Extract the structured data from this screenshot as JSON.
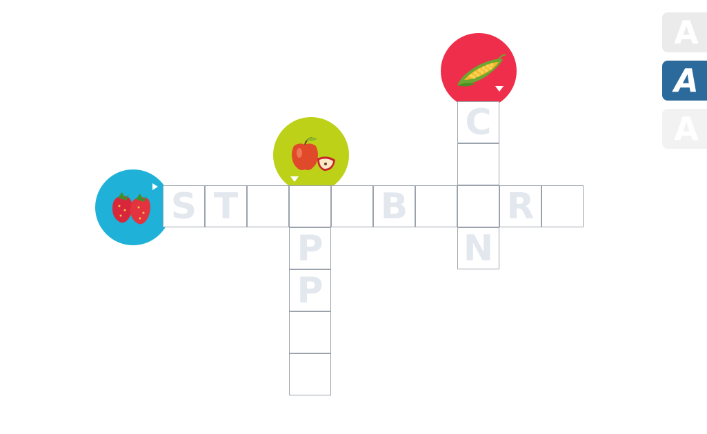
{
  "crossword": {
    "across_strawberry": [
      "S",
      "T",
      "",
      "",
      "",
      "B",
      "",
      "",
      "R",
      ""
    ],
    "down_apple": [
      "P",
      "P",
      "",
      ""
    ],
    "down_corn": [
      "C",
      "",
      "N"
    ]
  },
  "clues": {
    "strawberry": {
      "icon": "strawberry-icon",
      "color": "#1fb1d8"
    },
    "apple": {
      "icon": "apple-icon",
      "color": "#bcd118"
    },
    "corn": {
      "icon": "corn-icon",
      "color": "#ee2e4a"
    }
  },
  "font_buttons": {
    "a1": "A",
    "a2": "A",
    "a3": "A"
  }
}
